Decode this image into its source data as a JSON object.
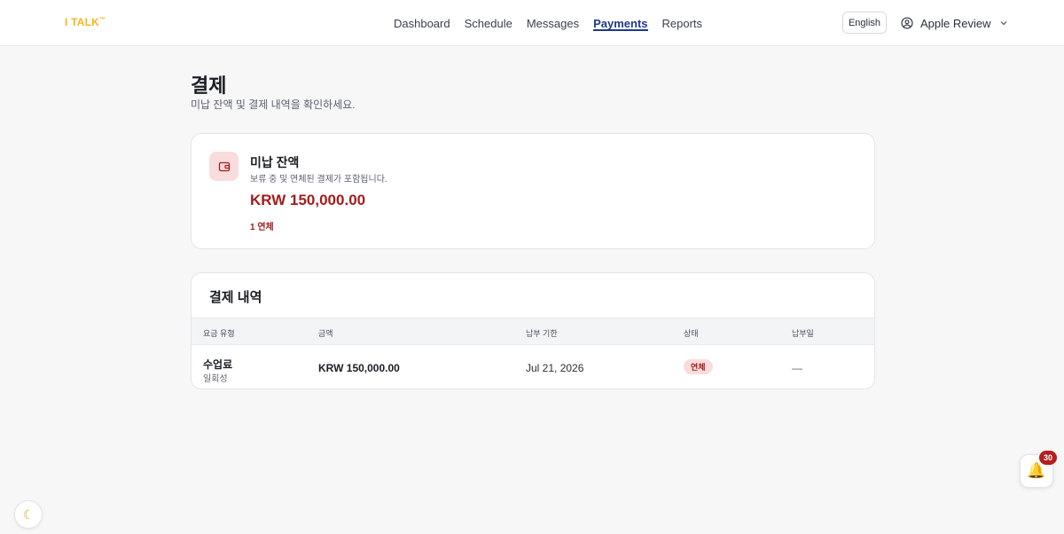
{
  "brand": {
    "logo_text": "I TALK",
    "logo_mark": "™",
    "accent": "#f4b71c"
  },
  "nav": {
    "items": [
      {
        "label": "Dashboard"
      },
      {
        "label": "Schedule"
      },
      {
        "label": "Messages"
      },
      {
        "label": "Payments",
        "active": true
      },
      {
        "label": "Reports"
      }
    ],
    "active_color": "#1e3a8a"
  },
  "header": {
    "language_label": "English",
    "user_name": "Apple Review",
    "user_icon": "user-circle-icon",
    "menu_icon": "chevron-down-icon"
  },
  "page": {
    "title": "결제",
    "subtitle": "미납 잔액 및 결제 내역을 확인하세요."
  },
  "balance": {
    "icon": "wallet-icon",
    "title": "미납 잔액",
    "description": "보류 중 및 연체된 결제가 포함됩니다.",
    "amount": "KRW 150,000.00",
    "overdue_text": "1 연체",
    "alert_color": "#a11d1d"
  },
  "history": {
    "title": "결제 내역",
    "columns": [
      "요금 유형",
      "금액",
      "납부 기한",
      "상태",
      "납부일"
    ],
    "rows": [
      {
        "type": "수업료",
        "type_sub": "일회성",
        "amount": "KRW 150,000.00",
        "due_date": "Jul 21, 2026",
        "status": "연체",
        "paid_date": "—"
      }
    ]
  },
  "floating": {
    "theme_icon": "moon-icon",
    "theme_glyph": "☾",
    "notification_icon": "bell-icon",
    "notification_glyph": "🔔",
    "notification_count": "30"
  }
}
